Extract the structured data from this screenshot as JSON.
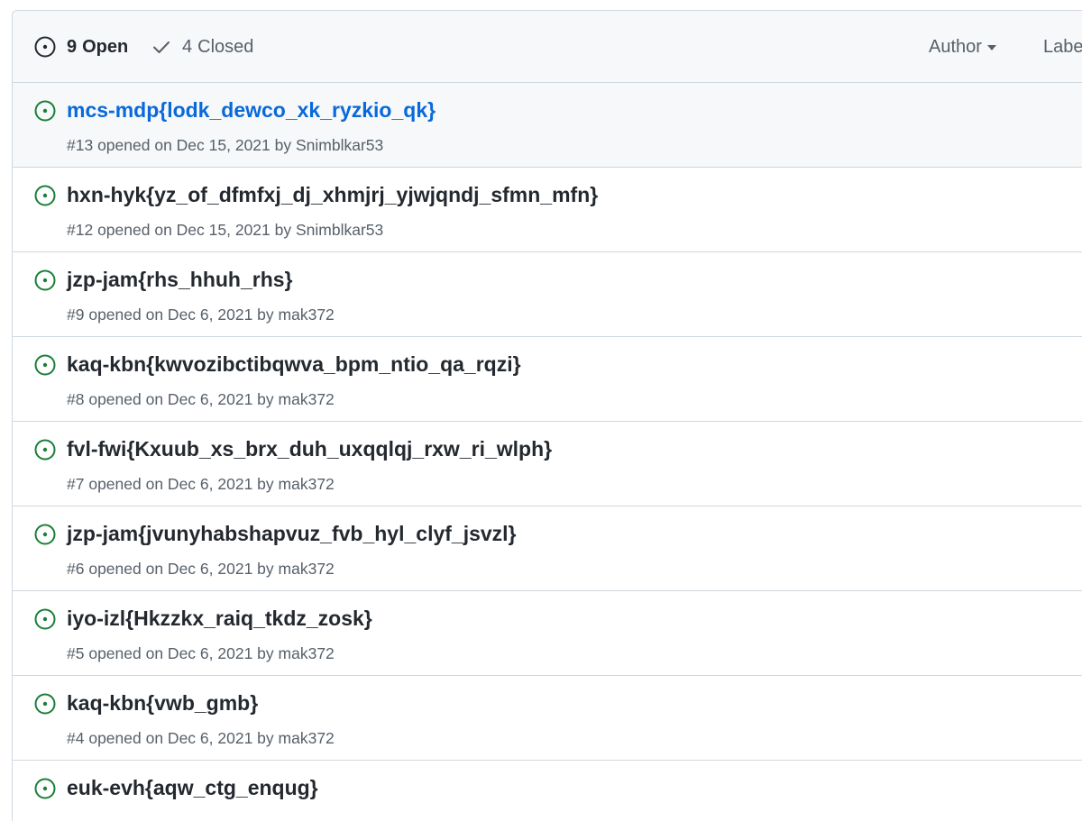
{
  "header": {
    "open_count": "9",
    "open_label": "Open",
    "closed_count": "4",
    "closed_label": "Closed",
    "filters": {
      "author": "Author",
      "label": "Labe"
    }
  },
  "colors": {
    "open_icon": "#1a7f37",
    "link_blue": "#0969da",
    "muted": "#57606a",
    "border": "#d0d7de"
  },
  "issues": [
    {
      "title": "mcs-mdp{lodk_dewco_xk_ryzkio_qk}",
      "number": "#13",
      "opened_on": "opened on Dec 15, 2021 by",
      "author": "Snimblkar53"
    },
    {
      "title": "hxn-hyk{yz_of_dfmfxj_dj_xhmjrj_yjwjqndj_sfmn_mfn}",
      "number": "#12",
      "opened_on": "opened on Dec 15, 2021 by",
      "author": "Snimblkar53"
    },
    {
      "title": "jzp-jam{rhs_hhuh_rhs}",
      "number": "#9",
      "opened_on": "opened on Dec 6, 2021 by",
      "author": "mak372"
    },
    {
      "title": "kaq-kbn{kwvozibctibqwva_bpm_ntio_qa_rqzi}",
      "number": "#8",
      "opened_on": "opened on Dec 6, 2021 by",
      "author": "mak372"
    },
    {
      "title": "fvl-fwi{Kxuub_xs_brx_duh_uxqqlqj_rxw_ri_wlph}",
      "number": "#7",
      "opened_on": "opened on Dec 6, 2021 by",
      "author": "mak372"
    },
    {
      "title": "jzp-jam{jvunyhabshapvuz_fvb_hyl_clyf_jsvzl}",
      "number": "#6",
      "opened_on": "opened on Dec 6, 2021 by",
      "author": "mak372"
    },
    {
      "title": "iyo-izl{Hkzzkx_raiq_tkdz_zosk}",
      "number": "#5",
      "opened_on": "opened on Dec 6, 2021 by",
      "author": "mak372"
    },
    {
      "title": "kaq-kbn{vwb_gmb}",
      "number": "#4",
      "opened_on": "opened on Dec 6, 2021 by",
      "author": "mak372"
    },
    {
      "title": "euk-evh{aqw_ctg_enqug}",
      "number": "",
      "opened_on": "",
      "author": ""
    }
  ]
}
